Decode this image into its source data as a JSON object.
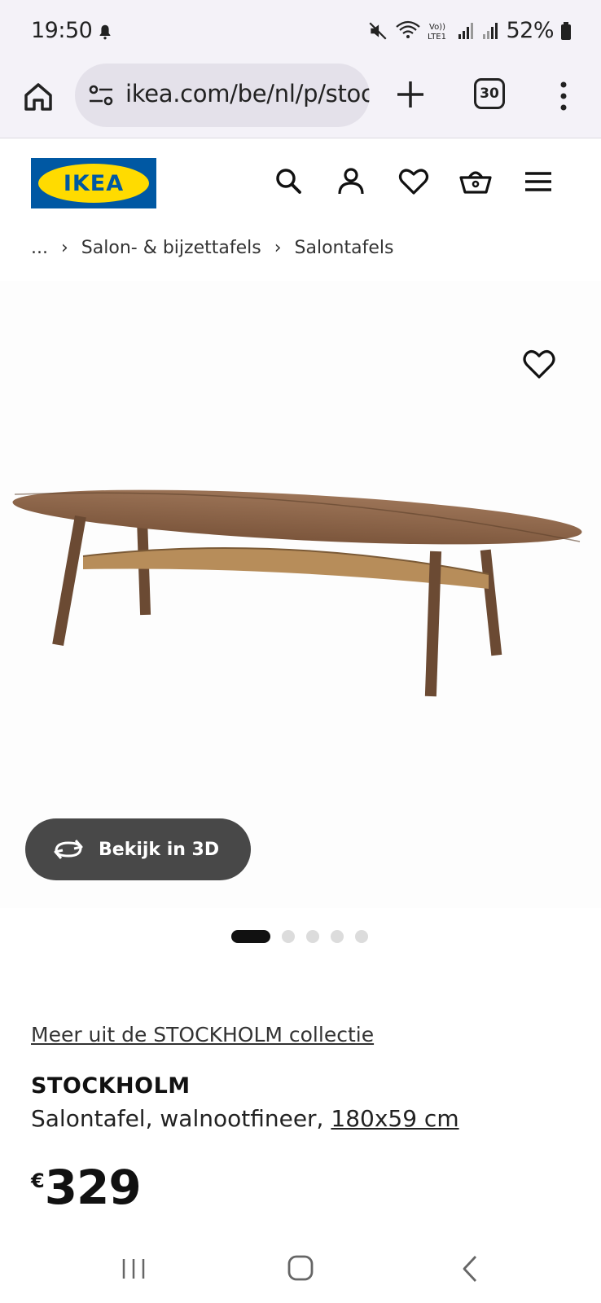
{
  "status_bar": {
    "time": "19:50",
    "battery": "52%",
    "icons": [
      "bell-icon",
      "mute-icon",
      "wifi-icon",
      "volte-icon",
      "signal-icon",
      "signal-icon",
      "battery-icon"
    ]
  },
  "browser": {
    "url": "ikea.com/be/nl/p/stoc",
    "tab_count": "30"
  },
  "site": {
    "logo_text": "IKEA",
    "brand_colors": {
      "blue": "#0058a3",
      "yellow": "#ffdb00"
    }
  },
  "breadcrumb": {
    "items": [
      "...",
      "Salon- & bijzettafels",
      "Salontafels"
    ]
  },
  "product": {
    "view_3d_label": "Bekijk in 3D",
    "image_count": 5,
    "active_image": 1,
    "collection_link": "Meer uit de STOCKHOLM collectie",
    "name": "STOCKHOLM",
    "description": "Salontafel, walnootfineer,",
    "size": "180x59 cm",
    "currency": "€",
    "price": "329"
  }
}
